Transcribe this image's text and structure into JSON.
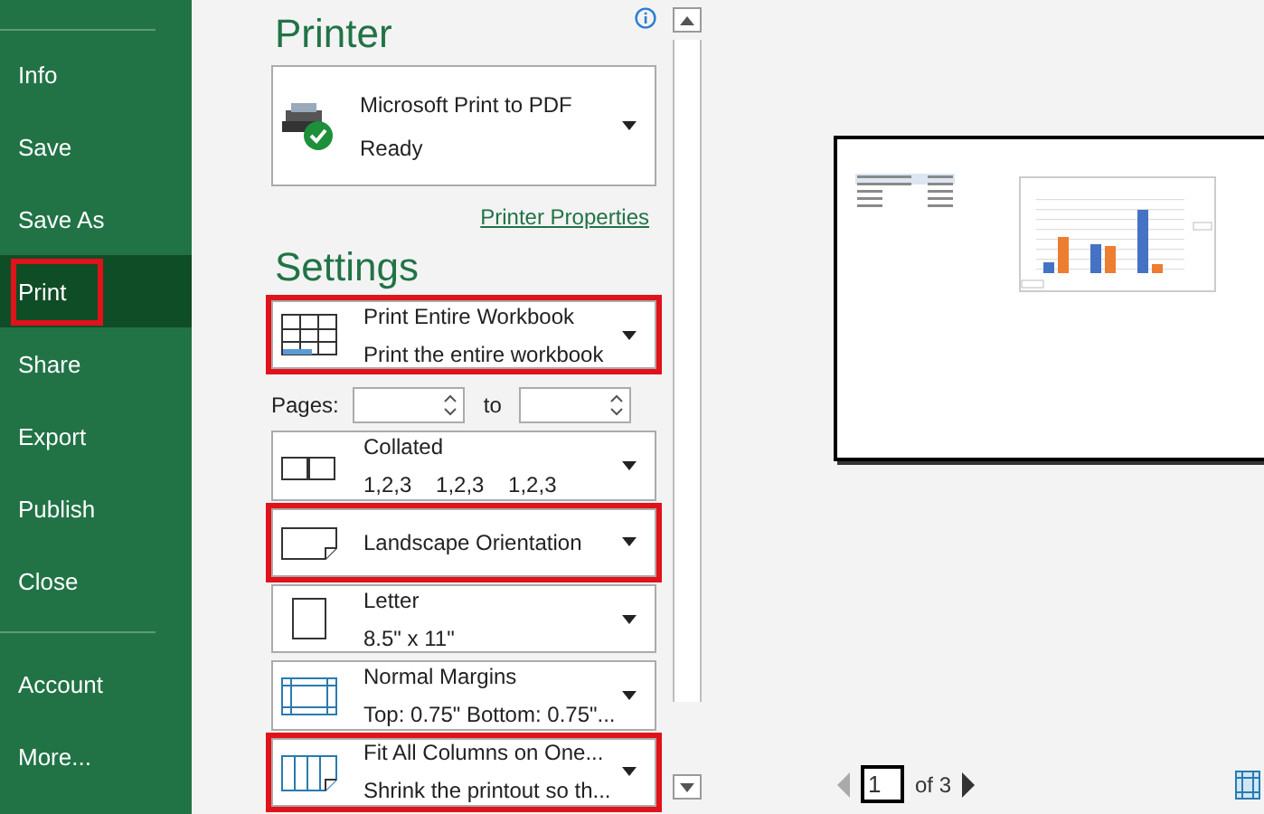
{
  "sidebar": {
    "items": [
      {
        "label": "Info",
        "selected": false,
        "highlighted": false
      },
      {
        "label": "Save",
        "selected": false,
        "highlighted": false
      },
      {
        "label": "Save As",
        "selected": false,
        "highlighted": false
      },
      {
        "label": "Print",
        "selected": true,
        "highlighted": true
      },
      {
        "label": "Share",
        "selected": false,
        "highlighted": false
      },
      {
        "label": "Export",
        "selected": false,
        "highlighted": false
      },
      {
        "label": "Publish",
        "selected": false,
        "highlighted": false
      },
      {
        "label": "Close",
        "selected": false,
        "highlighted": false
      }
    ],
    "footer_items": [
      {
        "label": "Account",
        "selected": false,
        "highlighted": false
      },
      {
        "label": "More...",
        "selected": false,
        "highlighted": false
      }
    ]
  },
  "printer": {
    "heading": "Printer",
    "device": {
      "name": "Microsoft Print to PDF",
      "status": "Ready"
    },
    "properties_link": "Printer Properties"
  },
  "settings": {
    "heading": "Settings",
    "items": [
      {
        "kind": "workbook",
        "title": "Print Entire Workbook",
        "subtitle": "Print the entire workbook",
        "highlighted": true
      },
      {
        "kind": "pages",
        "label": "Pages:",
        "to_label": "to"
      },
      {
        "kind": "collate",
        "title": "Collated",
        "subtitle": "1,2,3    1,2,3    1,2,3",
        "highlighted": false
      },
      {
        "kind": "landscape",
        "title": "Landscape Orientation",
        "highlighted": true
      },
      {
        "kind": "portrait",
        "title": "Letter",
        "subtitle": "8.5\" x 11\"",
        "highlighted": false
      },
      {
        "kind": "margins",
        "title": "Normal Margins",
        "subtitle": "Top: 0.75\" Bottom: 0.75\"...",
        "highlighted": false
      },
      {
        "kind": "fit",
        "title": "Fit All Columns on One...",
        "subtitle": "Shrink the printout so th...",
        "highlighted": true
      }
    ]
  },
  "preview": {
    "page_number": "1",
    "page_count": "of 3"
  }
}
